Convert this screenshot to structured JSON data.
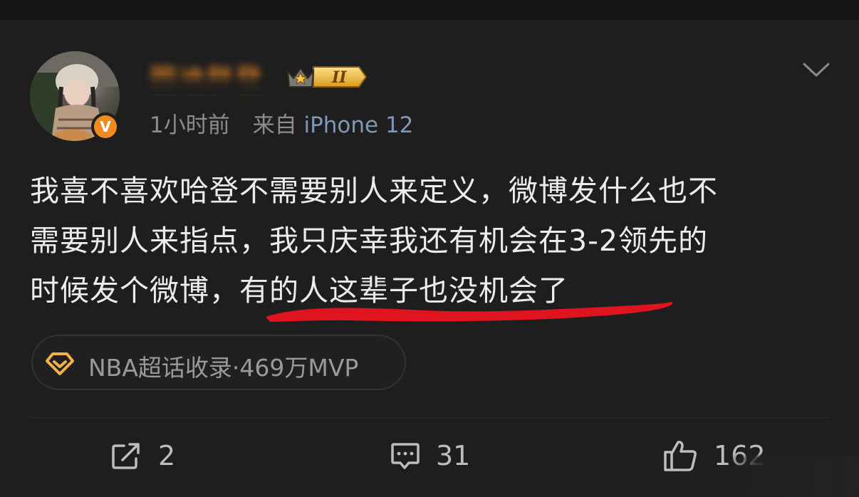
{
  "post": {
    "author_name": "圆迪胖登",
    "level_badge": "II",
    "verified_mark": "V",
    "time": "1小时前",
    "source": "来自",
    "device": "iPhone 12",
    "body_lines": [
      "我喜不喜欢哈登不需要别人来定义，微博发什么也不",
      "需要别人来指点，我只庆幸我还有机会在3-2领先的",
      "时候发个微博，"
    ],
    "body_highlight": "有的人这辈子也没机会了",
    "topic_label": "NBA超话收录·469万MVP"
  },
  "actions": {
    "share_count": "2",
    "comment_count": "31",
    "like_count": "162"
  },
  "colors": {
    "background": "#1e1e1e",
    "username": "#f08a24",
    "device_link": "#7f98b7",
    "underline_annotation": "#e0141e",
    "topic_icon": "#f0b34a"
  },
  "icons": {
    "avatar": "avatar-photo",
    "verified": "verified-v-icon",
    "level": "crown-level-badge-icon",
    "menu": "chevron-down-icon",
    "topic": "diamond-icon",
    "share": "share-icon",
    "comment": "comment-icon",
    "like": "thumbs-up-icon"
  }
}
